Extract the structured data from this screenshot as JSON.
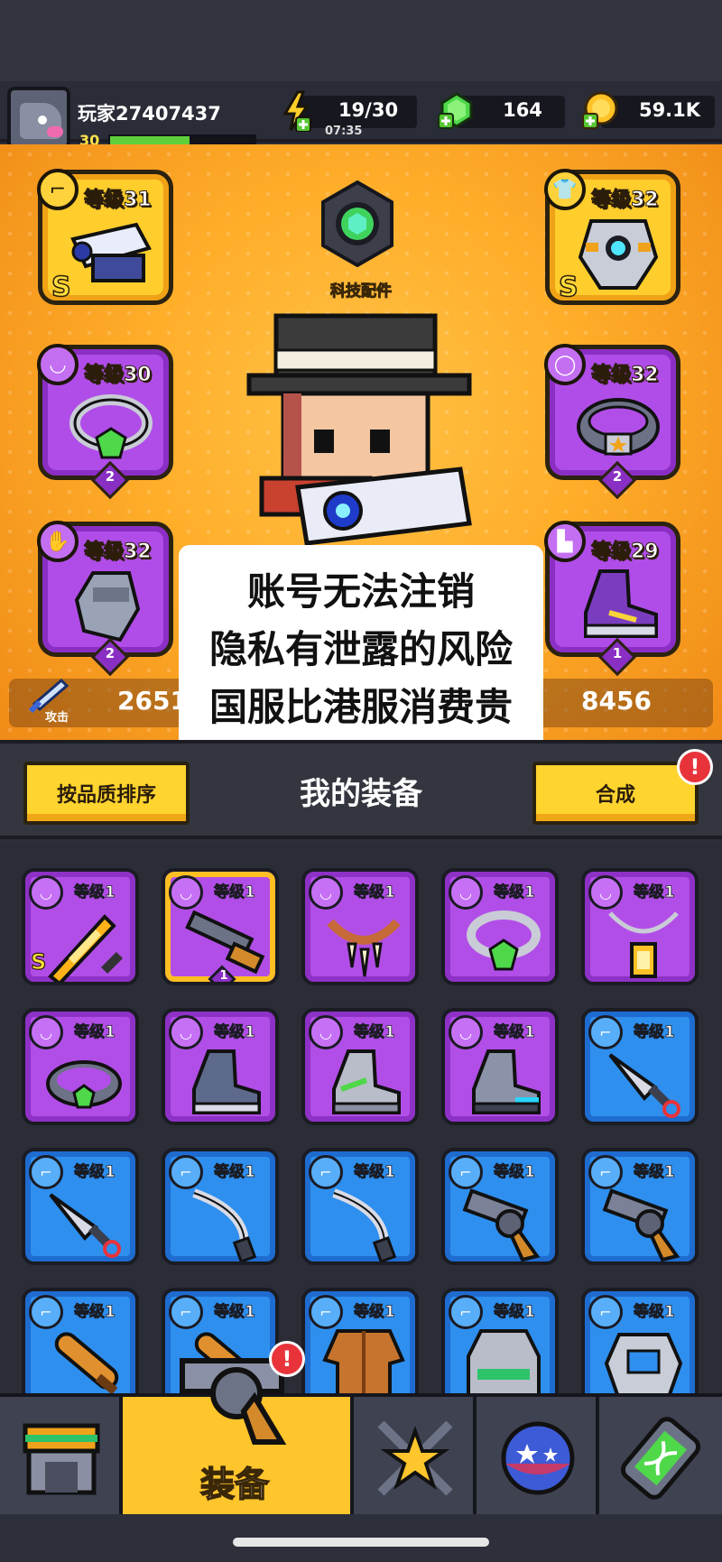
{
  "player": {
    "name": "玩家27407437",
    "level": "30",
    "xp_fraction": 0.55
  },
  "resources": {
    "energy": "19/30",
    "energy_timer": "07:35",
    "gems": "164",
    "coins": "59.1K"
  },
  "hero": {
    "tech_label": "科技配件",
    "slots": {
      "weapon": {
        "level": "等级31",
        "rank": "S"
      },
      "armor": {
        "level": "等级32",
        "rank": "S"
      },
      "necklace": {
        "level": "等级30",
        "stars": "2"
      },
      "belt": {
        "level": "等级32",
        "stars": "2"
      },
      "gloves": {
        "level": "等级32",
        "stars": "2"
      },
      "boots": {
        "level": "等级29",
        "stars": "1"
      }
    },
    "attack_label": "攻击",
    "attack_value": "2651",
    "defense_value": "8456"
  },
  "caption": {
    "line1": "账号无法注销",
    "line2": "隐私有泄露的风险",
    "line3": "国服比港服消费贵"
  },
  "equipment": {
    "sort_button": "按品质排序",
    "title": "我的装备",
    "merge_button": "合成",
    "alert_mark": "!"
  },
  "inventory": [
    {
      "name": "sword",
      "level": "等级1",
      "rank": "S",
      "color": "purple"
    },
    {
      "name": "shotgun",
      "level": "等级1",
      "stars": "1",
      "color": "purple"
    },
    {
      "name": "fang-necklace",
      "level": "等级1",
      "color": "purple"
    },
    {
      "name": "gem-ring",
      "level": "等级1",
      "color": "purple"
    },
    {
      "name": "lantern-necklace",
      "level": "等级1",
      "color": "purple"
    },
    {
      "name": "gem-belt",
      "level": "等级1",
      "color": "purple"
    },
    {
      "name": "boots-grey",
      "level": "等级1",
      "color": "purple"
    },
    {
      "name": "boots-green",
      "level": "等级1",
      "color": "purple"
    },
    {
      "name": "boots-blue",
      "level": "等级1",
      "color": "purple"
    },
    {
      "name": "kunai",
      "level": "等级1",
      "color": "blue"
    },
    {
      "name": "kunai",
      "level": "等级1",
      "color": "blue"
    },
    {
      "name": "katana",
      "level": "等级1",
      "color": "blue"
    },
    {
      "name": "katana",
      "level": "等级1",
      "color": "blue"
    },
    {
      "name": "revolver",
      "level": "等级1",
      "color": "blue"
    },
    {
      "name": "revolver",
      "level": "等级1",
      "color": "blue"
    },
    {
      "name": "bat",
      "level": "等级1",
      "color": "blue"
    },
    {
      "name": "bat",
      "level": "等级1",
      "color": "blue"
    },
    {
      "name": "leather-jacket",
      "level": "等级1",
      "color": "blue"
    },
    {
      "name": "vest",
      "level": "等级1",
      "color": "blue"
    },
    {
      "name": "armor",
      "level": "等级1",
      "color": "blue"
    }
  ],
  "nav": {
    "active_label": "装备",
    "alert_mark": "!"
  },
  "colors": {
    "accent": "#ffc52c",
    "rare": "#2e8fef",
    "epic": "#b24ee8"
  }
}
